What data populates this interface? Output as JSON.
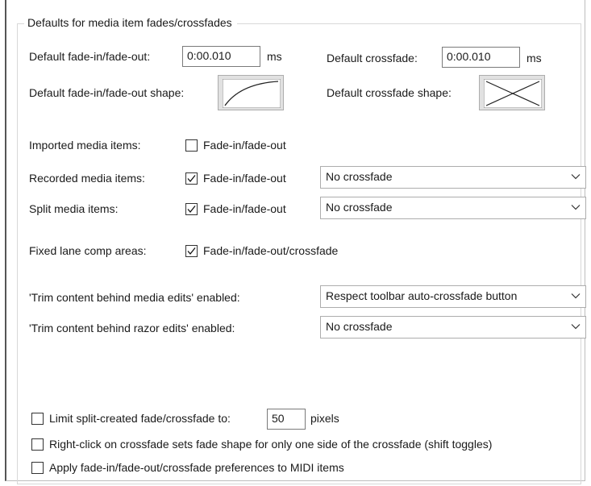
{
  "group": {
    "title": "Defaults for media item fades/crossfades"
  },
  "fade_length": {
    "label": "Default fade-in/fade-out:",
    "value": "0:00.010",
    "unit": "ms"
  },
  "crossfade_length": {
    "label": "Default crossfade:",
    "value": "0:00.010",
    "unit": "ms"
  },
  "fade_shape": {
    "label": "Default fade-in/fade-out shape:",
    "icon": "fade-curve-icon"
  },
  "crossfade_shape": {
    "label": "Default crossfade shape:",
    "icon": "crossfade-x-icon"
  },
  "imported": {
    "label": "Imported media items:",
    "checkbox_label": "Fade-in/fade-out",
    "checked": false
  },
  "recorded": {
    "label": "Recorded media items:",
    "checkbox_label": "Fade-in/fade-out",
    "checked": true,
    "dropdown": "No crossfade"
  },
  "split": {
    "label": "Split media items:",
    "checkbox_label": "Fade-in/fade-out",
    "checked": true,
    "dropdown": "No crossfade"
  },
  "fixed_lane": {
    "label": "Fixed lane comp areas:",
    "checkbox_label": "Fade-in/fade-out/crossfade",
    "checked": true
  },
  "trim_media": {
    "label": "'Trim content behind media edits' enabled:",
    "dropdown": "Respect toolbar auto-crossfade button"
  },
  "trim_razor": {
    "label": "'Trim content behind razor edits' enabled:",
    "dropdown": "No crossfade"
  },
  "limit_split": {
    "label": "Limit split-created fade/crossfade to:",
    "value": "50",
    "unit": "pixels",
    "checked": false
  },
  "right_click": {
    "label": "Right-click on crossfade sets fade shape for only one side of the crossfade (shift toggles)",
    "checked": false
  },
  "apply_midi": {
    "label": "Apply fade-in/fade-out/crossfade preferences to MIDI items",
    "checked": false
  },
  "colors": {
    "border": "#adadad",
    "button_face": "#e1e1e1",
    "text": "#1a1a1a"
  }
}
